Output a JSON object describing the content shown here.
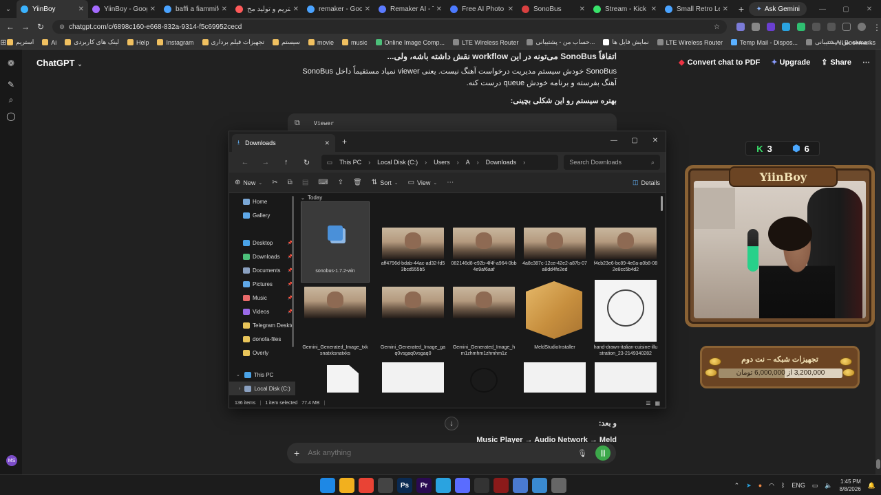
{
  "browser": {
    "tabs": [
      {
        "label": "YiinBoy",
        "color": "#3bb3ff",
        "active": true
      },
      {
        "label": "YiinBoy - Google",
        "color": "#a56bff",
        "active": false
      },
      {
        "label": "baffi a fiammifero",
        "color": "#4aa3ff",
        "active": false
      },
      {
        "label": "استریم و تولید مح",
        "color": "#ff5a5a",
        "active": false
      },
      {
        "label": "remaker - Google",
        "color": "#4aa3ff",
        "active": false
      },
      {
        "label": "Remaker AI - The",
        "color": "#5b7bff",
        "active": false
      },
      {
        "label": "Free AI Photo Edit",
        "color": "#4c7aff",
        "active": false
      },
      {
        "label": "SonoBus",
        "color": "#d94040",
        "active": false
      },
      {
        "label": "Stream - Kick Das",
        "color": "#39e36b",
        "active": false
      },
      {
        "label": "Small Retro Lemo",
        "color": "#4aa3ff",
        "active": false
      }
    ],
    "gemini_label": "Ask Gemini",
    "url": "chatgpt.com/c/6898c160-e668-832a-9314-f5c69952cecd",
    "bookmarks": [
      {
        "label": "استریم",
        "color": "#f0c060"
      },
      {
        "label": "Ai",
        "color": "#f0c060"
      },
      {
        "label": "لینک های کاربردی",
        "color": "#f0c060"
      },
      {
        "label": "Help",
        "color": "#f0c060"
      },
      {
        "label": "Instagram",
        "color": "#f0c060"
      },
      {
        "label": "تجهیزات فیلم برداری",
        "color": "#f0c060"
      },
      {
        "label": "سیستم",
        "color": "#f0c060"
      },
      {
        "label": "movie",
        "color": "#f0c060"
      },
      {
        "label": "music",
        "color": "#f0c060"
      },
      {
        "label": "Online Image Comp...",
        "color": "#4cc07a"
      },
      {
        "label": "LTE Wireless Router",
        "color": "#888888"
      },
      {
        "label": "حساب من - پشتیبانی...",
        "color": "#888888"
      },
      {
        "label": "نمایش فایل ها",
        "color": "#ffffff"
      },
      {
        "label": "LTE Wireless Router",
        "color": "#888888"
      },
      {
        "label": "Temp Mail - Dispos...",
        "color": "#5ab0ff"
      },
      {
        "label": "صفحه من - پشتیبانی...",
        "color": "#888888"
      }
    ],
    "all_bookmarks": "All Bookmarks"
  },
  "chat": {
    "brand": "ChatGPT",
    "convert_pdf": "Convert chat to PDF",
    "upgrade": "Upgrade",
    "share": "Share",
    "heading": "اتفاقاً SonoBus می‌تونه در این workflow نقش داشته باشه، ولی...",
    "paragraph": "SonoBus خودش سیستم مدیریت درخواست آهنگ نیست. یعنی viewer نمیاد مستقیماً داخل SonoBus آهنگ بفرسته و برنامه خودش queue درست کنه.",
    "better": "بهتره سیستم رو این شکلی بچینی:",
    "code_label": "Viewer",
    "after": "و بعد:",
    "flow": "Music Player → Audio Network → Meld",
    "composer_placeholder": "Ask anything",
    "avatar": "MS"
  },
  "explorer": {
    "tab_title": "Downloads",
    "breadcrumbs": [
      "This PC",
      "Local Disk (C:)",
      "Users",
      "A",
      "Downloads"
    ],
    "search_placeholder": "Search Downloads",
    "commands": {
      "new": "New",
      "sort": "Sort",
      "view": "View",
      "details": "Details"
    },
    "nav": [
      {
        "label": "Home",
        "color": "#7aa7d6",
        "pinned": false
      },
      {
        "label": "Gallery",
        "color": "#5fa8e8",
        "pinned": false
      },
      {
        "label": "Desktop",
        "color": "#4aa3e8",
        "pinned": true
      },
      {
        "label": "Downloads",
        "color": "#4cc07a",
        "pinned": true
      },
      {
        "label": "Documents",
        "color": "#8aa0c0",
        "pinned": true
      },
      {
        "label": "Pictures",
        "color": "#5fa8e8",
        "pinned": true
      },
      {
        "label": "Music",
        "color": "#e86a6a",
        "pinned": true
      },
      {
        "label": "Videos",
        "color": "#9a6ae8",
        "pinned": true
      },
      {
        "label": "Telegram Deskto",
        "color": "#e8c45a",
        "pinned": false
      },
      {
        "label": "donofa-files",
        "color": "#e8c45a",
        "pinned": false
      },
      {
        "label": "Overly",
        "color": "#e8c45a",
        "pinned": false
      }
    ],
    "this_pc": "This PC",
    "local_disk": "Local Disk (C:)",
    "group": "Today",
    "files": [
      {
        "name": "sonobus-1.7.2-win",
        "type": "installer"
      },
      {
        "name": "aff4796d-bdab-44ac-ad32-fd53bcd555b5",
        "type": "photo"
      },
      {
        "name": "082146d8-e92b-4f4f-a964-0bb4e9af6aaf",
        "type": "photo"
      },
      {
        "name": "4a8c387c-12ce-42e2-a87b-07a8dd4fe2ed",
        "type": "photo"
      },
      {
        "name": "f4cb23e6-bc89-4e0a-a0b8-082e8cc5b4d2",
        "type": "photo"
      },
      {
        "name": "Gemini_Generated_Image_txksnatxksnatxks",
        "type": "photo"
      },
      {
        "name": "Gemini_Generated_Image_gaq0vsgaq0vsgaq0",
        "type": "photo"
      },
      {
        "name": "Gemini_Generated_Image_hm1zhmhm1zhmhm1z",
        "type": "photo"
      },
      {
        "name": "MeldStudioInstaller",
        "type": "box"
      },
      {
        "name": "hand-drawn-italian-cuisine-illustration_23-2149340282",
        "type": "sketch"
      }
    ],
    "status": {
      "count": "136 items",
      "selected": "1 item selected",
      "size": "77.4 MB"
    }
  },
  "overlay": {
    "kick_count": "3",
    "twitch_count": "6",
    "cam_name": "YiinBoy",
    "goal_title": "تجهیزات شبکه – نت دوم",
    "goal_text": "3,200,000 از 6,000,000 تومان",
    "goal_progress": 0.533
  },
  "taskbar": {
    "apps": [
      {
        "label": "",
        "color": "#1e88e5"
      },
      {
        "label": "",
        "color": "#f2b01e"
      },
      {
        "label": "",
        "color": "#e94335"
      },
      {
        "label": "",
        "color": "#444444"
      },
      {
        "label": "Ps",
        "color": "#0a2a52"
      },
      {
        "label": "Pr",
        "color": "#2a0a52"
      },
      {
        "label": "",
        "color": "#2aa3e0"
      },
      {
        "label": "",
        "color": "#5a6cff"
      },
      {
        "label": "",
        "color": "#333333"
      },
      {
        "label": "",
        "color": "#8b1a1a"
      },
      {
        "label": "",
        "color": "#4a7ad0"
      },
      {
        "label": "",
        "color": "#3a8ad0"
      },
      {
        "label": "",
        "color": "#666666"
      }
    ],
    "lang": "ENG",
    "time": "1:45 PM",
    "date": "8/8/2026"
  }
}
